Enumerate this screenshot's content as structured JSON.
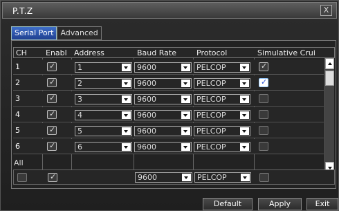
{
  "window": {
    "title": "P.T.Z",
    "close_label": "X"
  },
  "tabs": [
    {
      "label": "Serial Port",
      "active": true
    },
    {
      "label": "Advanced",
      "active": false
    }
  ],
  "table": {
    "headers": [
      "CH",
      "Enabl",
      "Address",
      "Baud Rate",
      "Protocol",
      "Simulative Crui"
    ],
    "rows": [
      {
        "ch": "1",
        "enable": true,
        "address": "1",
        "baud": "9600",
        "protocol": "PELCOP",
        "simulative": "on"
      },
      {
        "ch": "2",
        "enable": true,
        "address": "2",
        "baud": "9600",
        "protocol": "PELCOP",
        "simulative": "on-blue"
      },
      {
        "ch": "3",
        "enable": true,
        "address": "3",
        "baud": "9600",
        "protocol": "PELCOP",
        "simulative": "off"
      },
      {
        "ch": "4",
        "enable": true,
        "address": "4",
        "baud": "9600",
        "protocol": "PELCOP",
        "simulative": "off"
      },
      {
        "ch": "5",
        "enable": true,
        "address": "5",
        "baud": "9600",
        "protocol": "PELCOP",
        "simulative": "off"
      },
      {
        "ch": "6",
        "enable": true,
        "address": "6",
        "baud": "9600",
        "protocol": "PELCOP",
        "simulative": "off"
      }
    ]
  },
  "all": {
    "label": "All",
    "baud": "9600",
    "protocol": "PELCOP"
  },
  "buttons": {
    "default": "Default",
    "apply": "Apply",
    "exit": "Exit"
  }
}
